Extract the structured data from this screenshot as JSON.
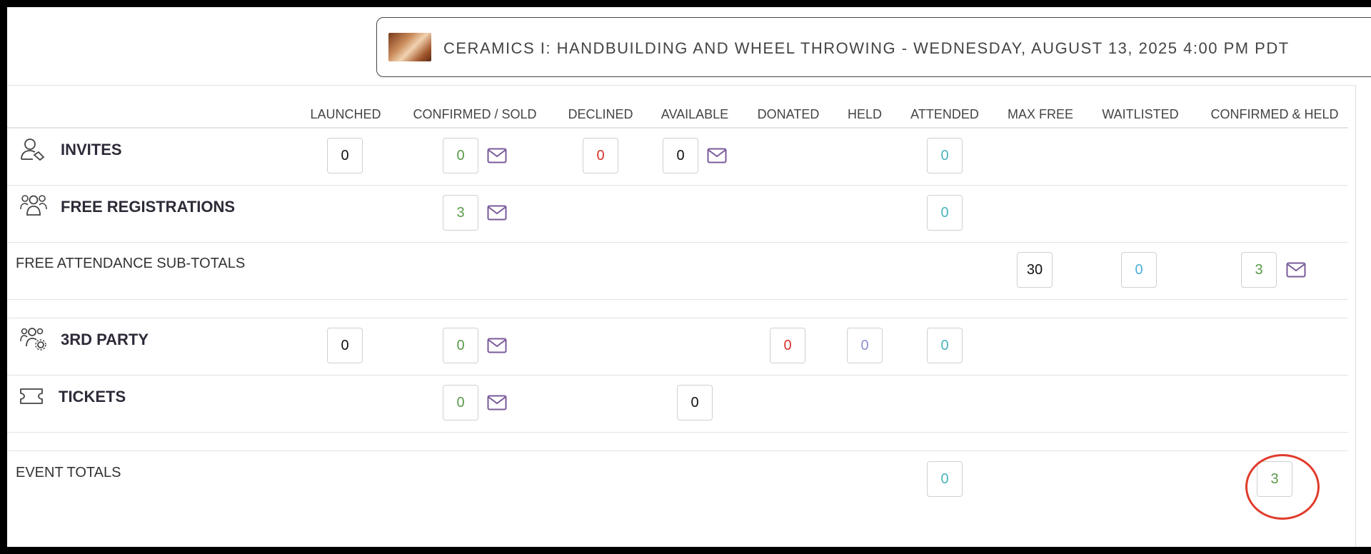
{
  "event": {
    "title": "CERAMICS I: HANDBUILDING AND WHEEL THROWING - WEDNESDAY, AUGUST 13, 2025 4:00 PM PDT",
    "thumbnail": "pottery-wheel-photo"
  },
  "columns": [
    "LAUNCHED",
    "CONFIRMED / SOLD",
    "DECLINED",
    "AVAILABLE",
    "DONATED",
    "HELD",
    "ATTENDED",
    "MAX FREE",
    "WAITLISTED",
    "CONFIRMED & HELD"
  ],
  "rows": {
    "invites": {
      "label": "INVITES",
      "icon": "user-tag-icon",
      "launched": "0",
      "confirmed": "0",
      "declined": "0",
      "available": "0",
      "attended": "0"
    },
    "free_registrations": {
      "label": "FREE REGISTRATIONS",
      "icon": "users-group-icon",
      "confirmed": "3",
      "attended": "0"
    },
    "free_subtotals": {
      "label": "FREE ATTENDANCE SUB-TOTALS",
      "max_free": "30",
      "waitlisted": "0",
      "confirmed_held": "3"
    },
    "third_party": {
      "label": "3RD PARTY",
      "icon": "users-gear-icon",
      "launched": "0",
      "confirmed": "0",
      "donated": "0",
      "held": "0",
      "attended": "0"
    },
    "tickets": {
      "label": "TICKETS",
      "icon": "ticket-icon",
      "confirmed": "0",
      "available": "0"
    },
    "event_totals": {
      "label": "EVENT TOTALS",
      "attended": "0",
      "confirmed_held": "3"
    }
  },
  "colors": {
    "green": "#5a9a4a",
    "red": "#d6322a",
    "teal": "#4ab3bd",
    "blue": "#4ab0d8",
    "lavender": "#8f8fd6",
    "mail_icon": "#7a5a9a",
    "highlight": "#e03c2c"
  }
}
